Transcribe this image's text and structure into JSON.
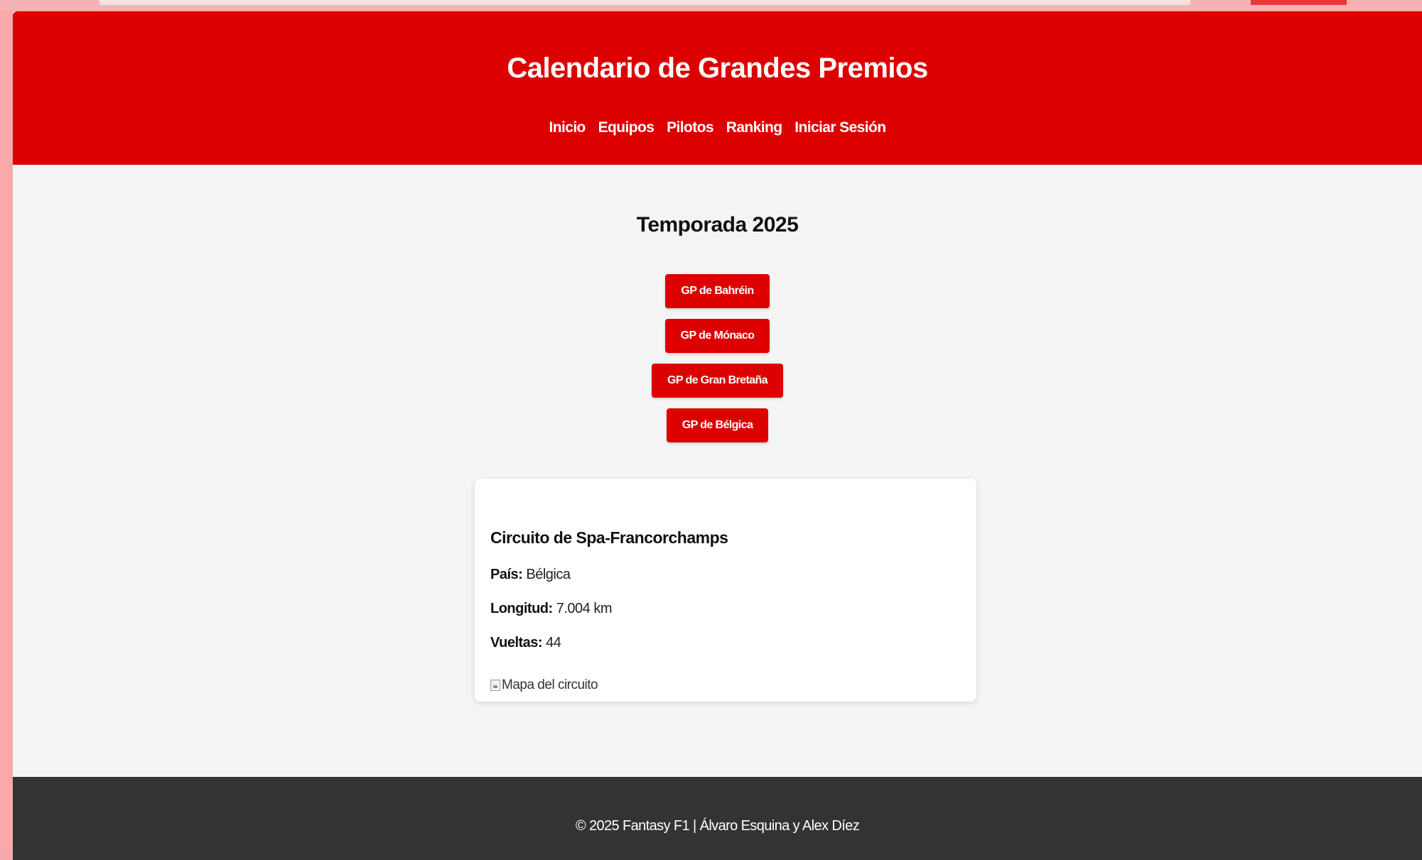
{
  "header": {
    "title": "Calendario de Grandes Premios",
    "nav": [
      "Inicio",
      "Equipos",
      "Pilotos",
      "Ranking",
      "Iniciar Sesión"
    ]
  },
  "main": {
    "season_title": "Temporada 2025",
    "grand_prix_buttons": [
      "GP de Bahréin",
      "GP de Mónaco",
      "GP de Gran Bretaña",
      "GP de Bélgica"
    ],
    "circuit": {
      "name": "Circuito de Spa-Francorchamps",
      "country_label": "País:",
      "country_value": "Bélgica",
      "length_label": "Longitud:",
      "length_value": "7.004 km",
      "laps_label": "Vueltas:",
      "laps_value": "44",
      "map_alt": "Mapa del circuito"
    }
  },
  "footer": {
    "text": "© 2025 Fantasy F1 | Álvaro Esquina y Alex Díez"
  },
  "colors": {
    "primary": "#dd0000",
    "background": "#f4f4f4",
    "footer": "#333333"
  },
  "icons": {
    "map_image": "broken-image-icon"
  }
}
